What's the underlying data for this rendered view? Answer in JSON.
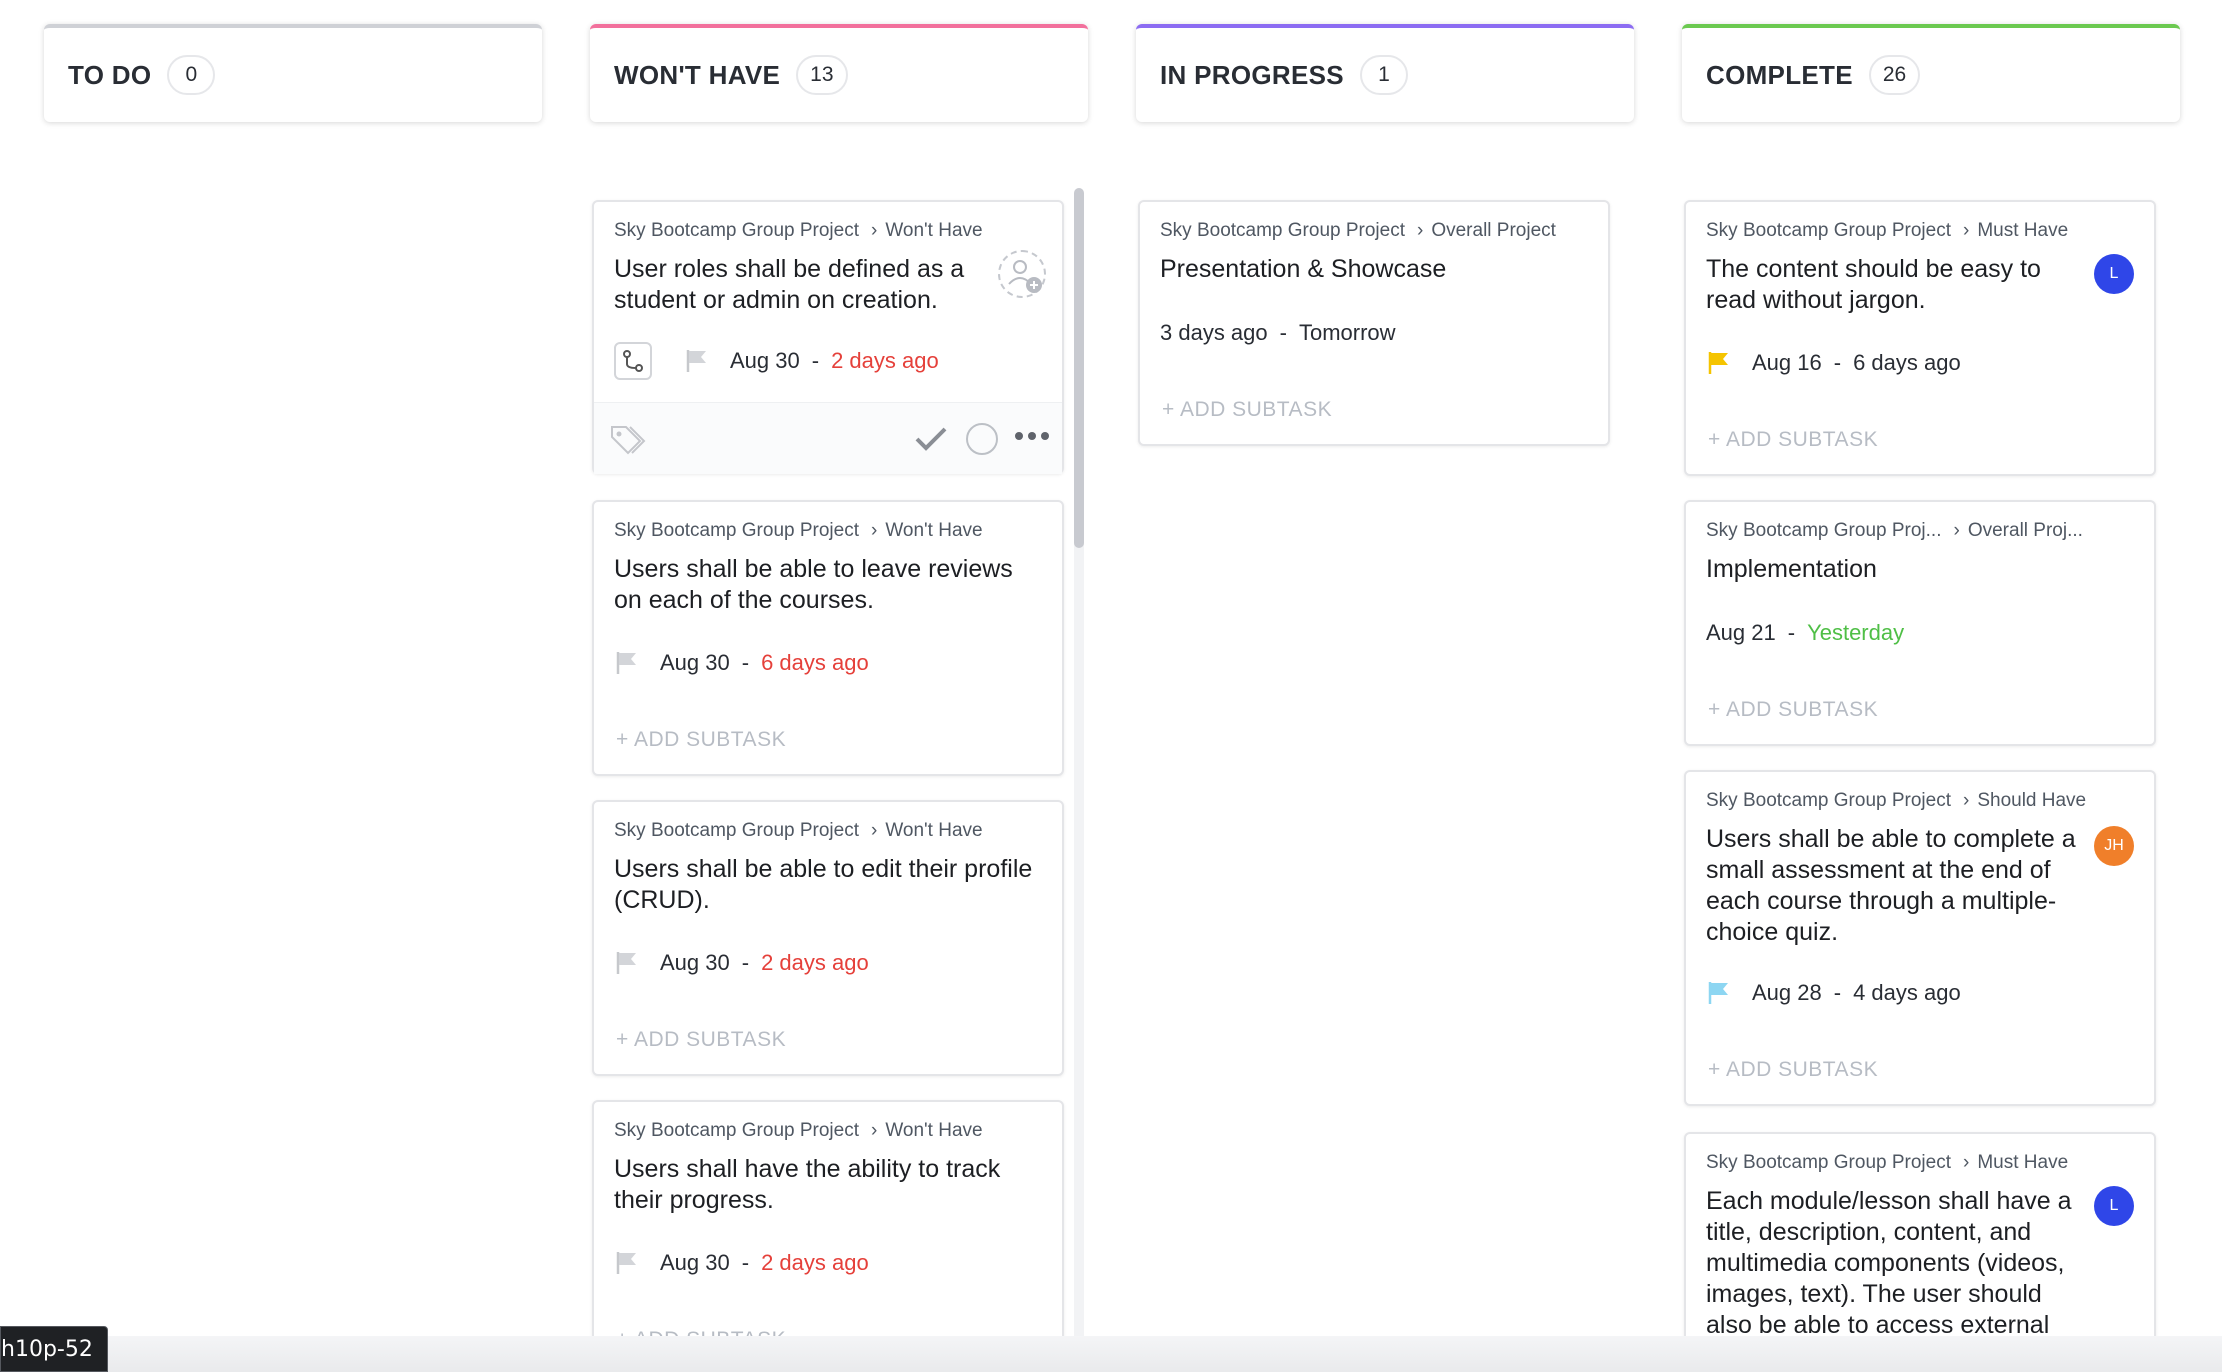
{
  "colors": {
    "todo": "#cfd1d6",
    "wont_have": "#f2709c",
    "in_progress": "#8c6cf2",
    "complete": "#6bc950",
    "avatar_blue": "#2f46e8",
    "avatar_orange": "#f07f2a",
    "flag_yellow": "#f5c400",
    "flag_cyan": "#8dd6f2",
    "flag_grey": "#d3d5d9"
  },
  "columns": [
    {
      "title": "TO DO",
      "count": "0"
    },
    {
      "title": "WON'T HAVE",
      "count": "13"
    },
    {
      "title": "IN PROGRESS",
      "count": "1"
    },
    {
      "title": "COMPLETE",
      "count": "26"
    }
  ],
  "wont_have_cards": [
    {
      "project": "Sky Bootcamp Group Project",
      "list": "Won't Have",
      "title": "User roles shall be defined as a student or admin on creation.",
      "date": "Aug 30",
      "relative": "2 days ago",
      "flag_icon": "flag-grey-icon"
    },
    {
      "project": "Sky Bootcamp Group Project",
      "list": "Won't Have",
      "title": "Users shall be able to leave re­views on each of the courses.",
      "date": "Aug 30",
      "relative": "6 days ago",
      "add_subtask": "+ ADD SUBTASK"
    },
    {
      "project": "Sky Bootcamp Group Project",
      "list": "Won't Have",
      "title": "Users shall be able to edit their profile (CRUD).",
      "date": "Aug 30",
      "relative": "2 days ago",
      "add_subtask": "+ ADD SUBTASK"
    },
    {
      "project": "Sky Bootcamp Group Project",
      "list": "Won't Have",
      "title": "Users shall have the ability to track their progress.",
      "date": "Aug 30",
      "relative": "2 days ago",
      "add_subtask": "+ ADD SUBTASK"
    }
  ],
  "in_progress_cards": [
    {
      "project": "Sky Bootcamp Group Project",
      "list": "Overall Project",
      "title": "Presentation & Showcase",
      "start": "3 days ago",
      "due": "Tomorrow",
      "add_subtask": "+ ADD SUBTASK"
    }
  ],
  "complete_cards": [
    {
      "project": "Sky Bootcamp Group Project",
      "list": "Must Have",
      "title": "The content should be easy to read without jargon.",
      "avatar": "L",
      "date": "Aug 16",
      "relative": "6 days ago",
      "add_subtask": "+ ADD SUBTASK"
    },
    {
      "project": "Sky Bootcamp Group Proj...",
      "list": "Overall Proj...",
      "title": "Implementation",
      "date": "Aug 21",
      "relative": "Yesterday",
      "add_subtask": "+ ADD SUBTASK"
    },
    {
      "project": "Sky Bootcamp Group Project",
      "list": "Should Have",
      "title": "Users shall be able to complete a small assessment at the end of each course through a multi­ple-choice quiz.",
      "avatar": "JH",
      "date": "Aug 28",
      "relative": "4 days ago",
      "add_subtask": "+ ADD SUBTASK"
    },
    {
      "project": "Sky Bootcamp Group Project",
      "list": "Must Have",
      "title": "Each module/lesson shall have a title, description, content, and multimedia components (videos, images, text). The user should also be able to ac­cess external resources",
      "avatar": "L"
    }
  ],
  "bottom_label": "h10p-52"
}
